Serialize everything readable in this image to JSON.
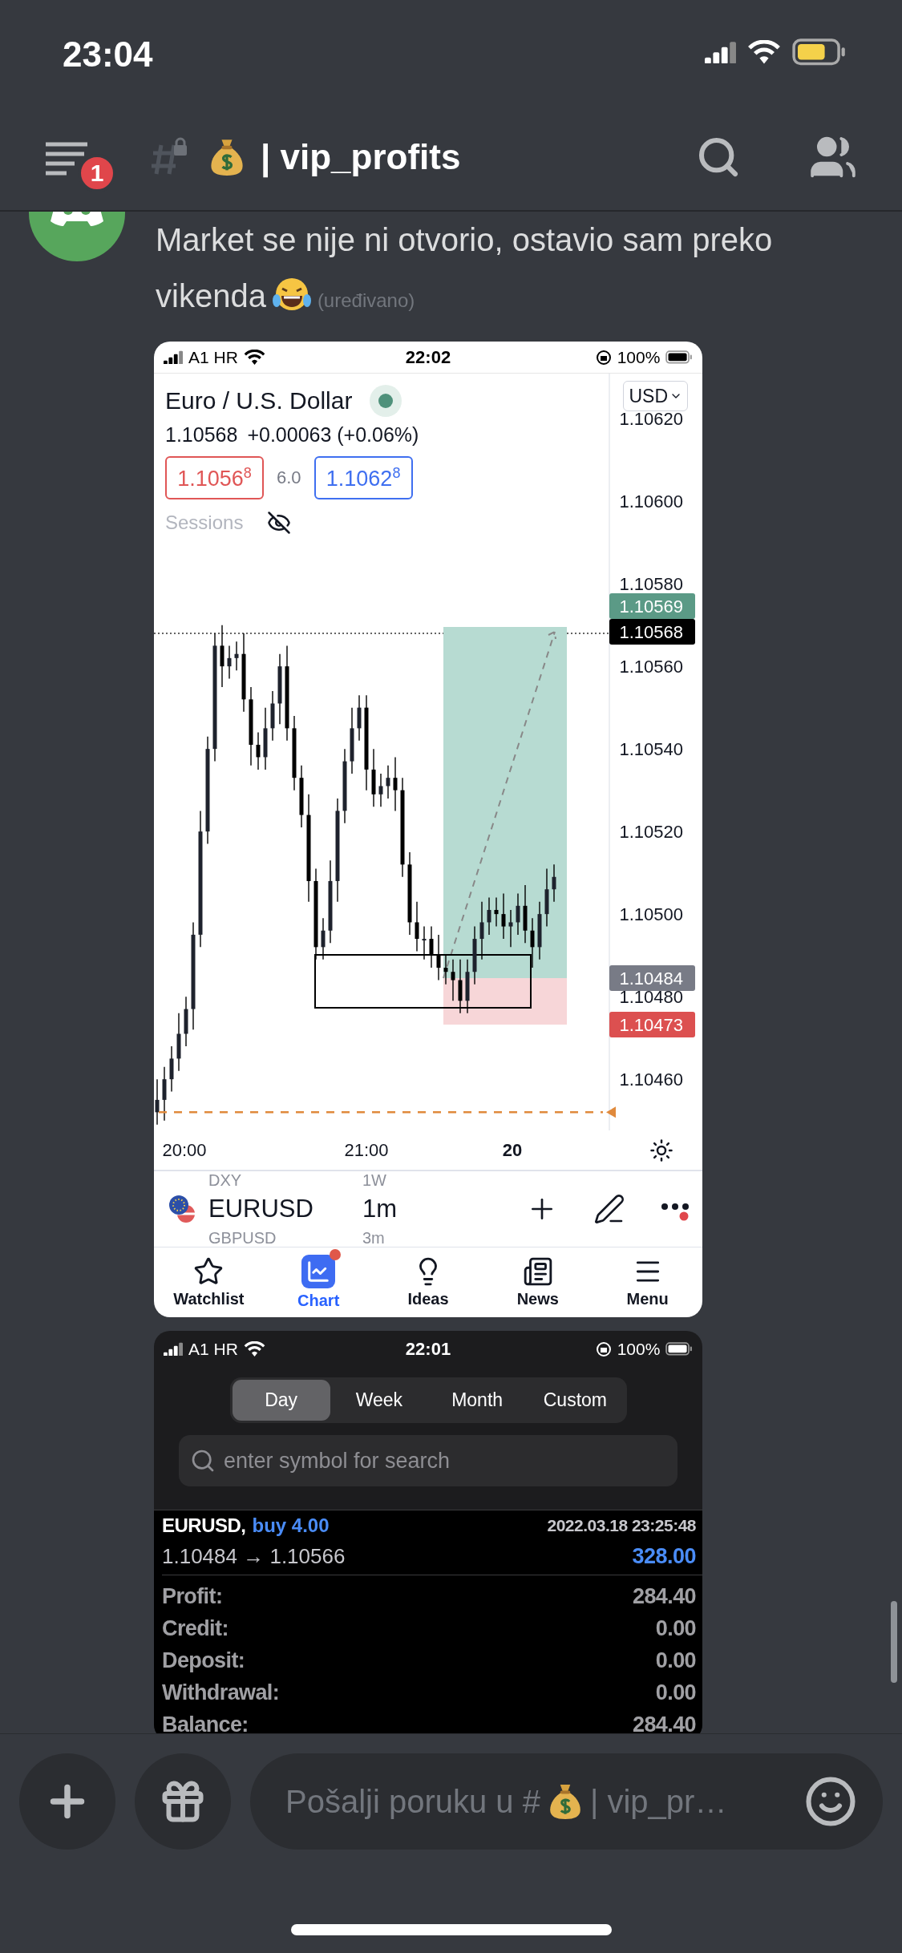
{
  "status_bar": {
    "time": "23:04"
  },
  "header": {
    "notification_count": "1",
    "channel_name": "| vip_profits"
  },
  "message": {
    "text": "Market se nije ni otvorio, ostavio sam preko vikenda",
    "edited": "(uređivano)"
  },
  "chart_screenshot": {
    "status_bar": {
      "carrier": "A1 HR",
      "time": "22:02",
      "battery": "100%"
    },
    "title": "Euro / U.S. Dollar",
    "currency": "USD",
    "last": "1.10568",
    "change": "+0.00063 (+0.06%)",
    "bid": "1.1056$^{8}$",
    "spread": "6.0",
    "ask": "1.1062$^{8}$",
    "sessions_label": "Sessions",
    "chart_data": {
      "type": "candlestick",
      "categories": [
        null,
        null,
        null,
        null,
        null,
        null,
        null,
        null,
        null,
        null,
        null,
        null,
        null,
        null,
        null,
        null,
        null,
        null,
        null,
        null,
        null,
        null,
        null,
        null,
        null,
        null,
        null,
        null,
        null,
        null,
        null,
        null,
        null,
        null,
        null,
        null,
        null,
        null,
        null,
        null,
        null,
        null,
        null,
        null,
        null,
        null,
        null,
        null,
        null,
        null,
        null,
        null,
        null,
        null,
        null,
        null
      ],
      "ohlc": [
        [
          1.10452,
          1.1046,
          1.10449,
          1.10455
        ],
        [
          1.10455,
          1.10463,
          1.1045,
          1.1046
        ],
        [
          1.1046,
          1.10468,
          1.10457,
          1.10465
        ],
        [
          1.10465,
          1.10476,
          1.10462,
          1.10471
        ],
        [
          1.10471,
          1.1048,
          1.10468,
          1.10477
        ],
        [
          1.10477,
          1.10498,
          1.10472,
          1.10495
        ],
        [
          1.10495,
          1.10525,
          1.10492,
          1.1052
        ],
        [
          1.1052,
          1.10543,
          1.10517,
          1.1054
        ],
        [
          1.1054,
          1.10568,
          1.10537,
          1.10565
        ],
        [
          1.10565,
          1.1057,
          1.10555,
          1.1056
        ],
        [
          1.1056,
          1.10565,
          1.10557,
          1.10562
        ],
        [
          1.10562,
          1.10566,
          1.10559,
          1.10563
        ],
        [
          1.10563,
          1.10568,
          1.10549,
          1.10552
        ],
        [
          1.10552,
          1.10555,
          1.10536,
          1.10541
        ],
        [
          1.10541,
          1.10544,
          1.10535,
          1.10538
        ],
        [
          1.10538,
          1.1055,
          1.10535,
          1.10545
        ],
        [
          1.10545,
          1.10554,
          1.10542,
          1.10551
        ],
        [
          1.10551,
          1.10563,
          1.10546,
          1.1056
        ],
        [
          1.1056,
          1.10565,
          1.10542,
          1.10545
        ],
        [
          1.10545,
          1.10548,
          1.1053,
          1.10533
        ],
        [
          1.10533,
          1.10536,
          1.10521,
          1.10524
        ],
        [
          1.10524,
          1.10529,
          1.10503,
          1.10508
        ],
        [
          1.10508,
          1.10511,
          1.10489,
          1.10492
        ],
        [
          1.10492,
          1.10499,
          1.10489,
          1.10496
        ],
        [
          1.10496,
          1.10513,
          1.10493,
          1.10508
        ],
        [
          1.10508,
          1.10528,
          1.10503,
          1.10525
        ],
        [
          1.10525,
          1.1054,
          1.10522,
          1.10537
        ],
        [
          1.10537,
          1.1055,
          1.10534,
          1.10545
        ],
        [
          1.10545,
          1.10553,
          1.10542,
          1.1055
        ],
        [
          1.1055,
          1.10553,
          1.1053,
          1.10535
        ],
        [
          1.10535,
          1.1054,
          1.10526,
          1.10529
        ],
        [
          1.10529,
          1.10534,
          1.10526,
          1.10531
        ],
        [
          1.10531,
          1.10536,
          1.10528,
          1.10533
        ],
        [
          1.10533,
          1.10538,
          1.10525,
          1.1053
        ],
        [
          1.1053,
          1.10533,
          1.10509,
          1.10512
        ],
        [
          1.10512,
          1.10515,
          1.10495,
          1.10498
        ],
        [
          1.10498,
          1.10503,
          1.10491,
          1.10494
        ],
        [
          1.10494,
          1.10497,
          1.10489,
          1.10494
        ],
        [
          1.10494,
          1.10497,
          1.10487,
          1.1049
        ],
        [
          1.1049,
          1.10495,
          1.10484,
          1.10487
        ],
        [
          1.10487,
          1.1049,
          1.10483,
          1.10486
        ],
        [
          1.10486,
          1.10489,
          1.10479,
          1.10484
        ],
        [
          1.10484,
          1.10489,
          1.10476,
          1.10479
        ],
        [
          1.10479,
          1.10489,
          1.10476,
          1.10486
        ],
        [
          1.10486,
          1.10497,
          1.10483,
          1.10494
        ],
        [
          1.10494,
          1.10503,
          1.10489,
          1.10498
        ],
        [
          1.10498,
          1.10504,
          1.10495,
          1.10501
        ],
        [
          1.10501,
          1.10504,
          1.10497,
          1.105
        ],
        [
          1.105,
          1.10505,
          1.10494,
          1.10497
        ],
        [
          1.10497,
          1.10501,
          1.10492,
          1.10498
        ],
        [
          1.10498,
          1.10505,
          1.10495,
          1.10502
        ],
        [
          1.10502,
          1.10507,
          1.10493,
          1.10496
        ],
        [
          1.10496,
          1.10499,
          1.10487,
          1.10492
        ],
        [
          1.10492,
          1.10503,
          1.10489,
          1.105
        ],
        [
          1.105,
          1.10511,
          1.10497,
          1.10506
        ],
        [
          1.10506,
          1.10512,
          1.10503,
          1.10509
        ]
      ],
      "yticks": [
        {
          "value": 1.1062,
          "label": "1.10620"
        },
        {
          "value": 1.106,
          "label": "1.10600"
        },
        {
          "value": 1.1058,
          "label": "1.10580"
        },
        {
          "value": 1.1056,
          "label": "1.10560"
        },
        {
          "value": 1.1054,
          "label": "1.10540"
        },
        {
          "value": 1.1052,
          "label": "1.10520"
        },
        {
          "value": 1.105,
          "label": "1.10500"
        },
        {
          "value": 1.1048,
          "label": "1.10480"
        },
        {
          "value": 1.1046,
          "label": "1.10460"
        }
      ],
      "ylim": [
        1.104476,
        1.106309
      ],
      "ref_lines": [
        {
          "axis": "y",
          "value": 1.10568,
          "color": "#333333"
        },
        {
          "axis": "y",
          "value": 1.10452,
          "color": "#e08a3c"
        }
      ]
    },
    "time_axis": [
      {
        "text": "20:00",
        "kind": "time"
      },
      {
        "text": "21:00",
        "kind": "time"
      },
      {
        "text": "20",
        "kind": "day"
      }
    ],
    "price_tags": [
      {
        "text": "1.10569",
        "color": "#5b9a86"
      },
      {
        "text": "1.10568",
        "color": "#000000"
      },
      {
        "text": "1.10484",
        "color": "#787b86"
      },
      {
        "text": "1.10473",
        "color": "#dc5050"
      }
    ],
    "symbol_picker": {
      "above": [
        "DXY",
        "1W"
      ],
      "symbol": "EURUSD",
      "interval": "1m",
      "below": [
        "GBPUSD",
        "3m"
      ]
    },
    "tabs": [
      {
        "label": "Watchlist",
        "selected": false,
        "badge": false
      },
      {
        "label": "Chart",
        "selected": true,
        "badge": true
      },
      {
        "label": "Ideas",
        "selected": false,
        "badge": false
      },
      {
        "label": "News",
        "selected": false,
        "badge": false
      },
      {
        "label": "Menu",
        "selected": false,
        "badge": false
      }
    ]
  },
  "report_screenshot": {
    "status_bar": {
      "carrier": "A1 HR",
      "time": "22:01",
      "battery": "100%"
    },
    "periods": [
      {
        "label": "Day",
        "selected": true
      },
      {
        "label": "Week",
        "selected": false
      },
      {
        "label": "Month",
        "selected": false
      },
      {
        "label": "Custom",
        "selected": false
      }
    ],
    "search": {
      "placeholder": "enter symbol for search"
    },
    "trade": {
      "symbol": "EURUSD,",
      "side": "buy 4.00",
      "time": "2022.03.18 23:25:48",
      "prices": "1.10484 → 1.10566",
      "result": "328.00"
    },
    "summary": [
      {
        "label": "Profit:",
        "value": "284.40"
      },
      {
        "label": "Credit:",
        "value": "0.00"
      },
      {
        "label": "Deposit:",
        "value": "0.00"
      },
      {
        "label": "Withdrawal:",
        "value": "0.00"
      },
      {
        "label": "Balance:",
        "value": "284.40"
      }
    ]
  },
  "composer": {
    "placeholder_start": "Pošalji poruku u #",
    "placeholder_end": "| vip_pr…"
  }
}
